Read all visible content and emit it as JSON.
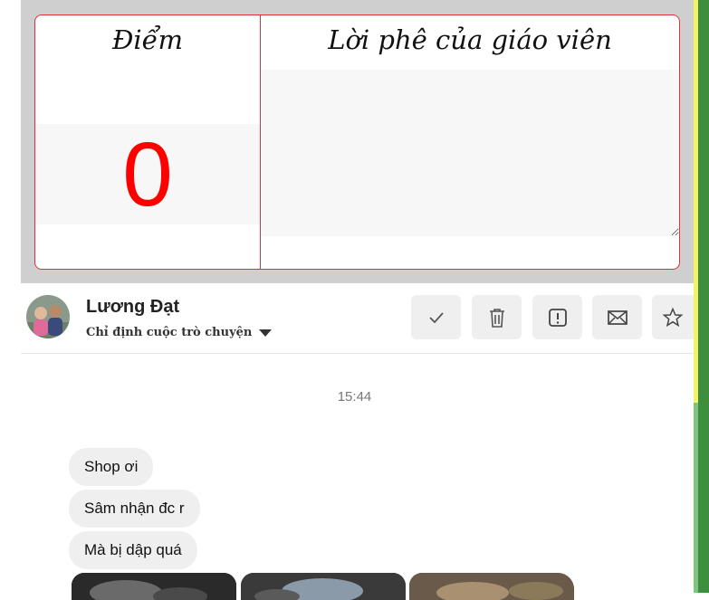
{
  "grade": {
    "score_label": "Điểm",
    "comment_label": "Lời phê của giáo viên",
    "score_value": "0",
    "comment_value": ""
  },
  "chat": {
    "user_name": "Lương Đạt",
    "assign_label": "Chỉ định cuộc trò chuyện",
    "timestamp": "15:44",
    "messages": [
      "Shop ơi",
      "Sâm nhận đc r",
      "Mà bị dập quá"
    ]
  },
  "toolbar": {
    "icons": [
      "check-icon",
      "trash-icon",
      "report-icon",
      "mail-icon",
      "star-icon"
    ]
  },
  "colors": {
    "accent_red": "#ff0000",
    "border_red": "#e0303a",
    "gray_panel": "#cfcfcf",
    "bubble_bg": "#efefef"
  }
}
